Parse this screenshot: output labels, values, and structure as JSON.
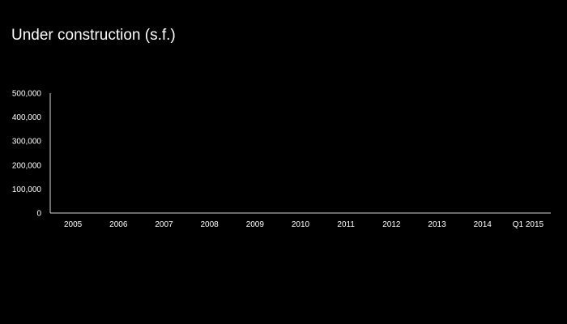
{
  "colors": {
    "background": "#000000",
    "text": "#ffffff",
    "axis": "#d9d9d9"
  },
  "chart_data": {
    "type": "bar",
    "title": "Under construction (s.f.)",
    "xlabel": "",
    "ylabel": "",
    "categories": [
      "2005",
      "2006",
      "2007",
      "2008",
      "2009",
      "2010",
      "2011",
      "2012",
      "2013",
      "2014",
      "Q1 2015"
    ],
    "series": [
      {
        "values": [
          0,
          0,
          0,
          0,
          0,
          0,
          0,
          0,
          0,
          0,
          0
        ]
      }
    ],
    "ylim": [
      0,
      500000
    ],
    "yticks": [
      0,
      100000,
      200000,
      300000,
      400000,
      500000
    ],
    "ytick_labels": [
      "0",
      "100,000",
      "200,000",
      "300,000",
      "400,000",
      "500,000"
    ],
    "grid": false,
    "legend": "none"
  }
}
